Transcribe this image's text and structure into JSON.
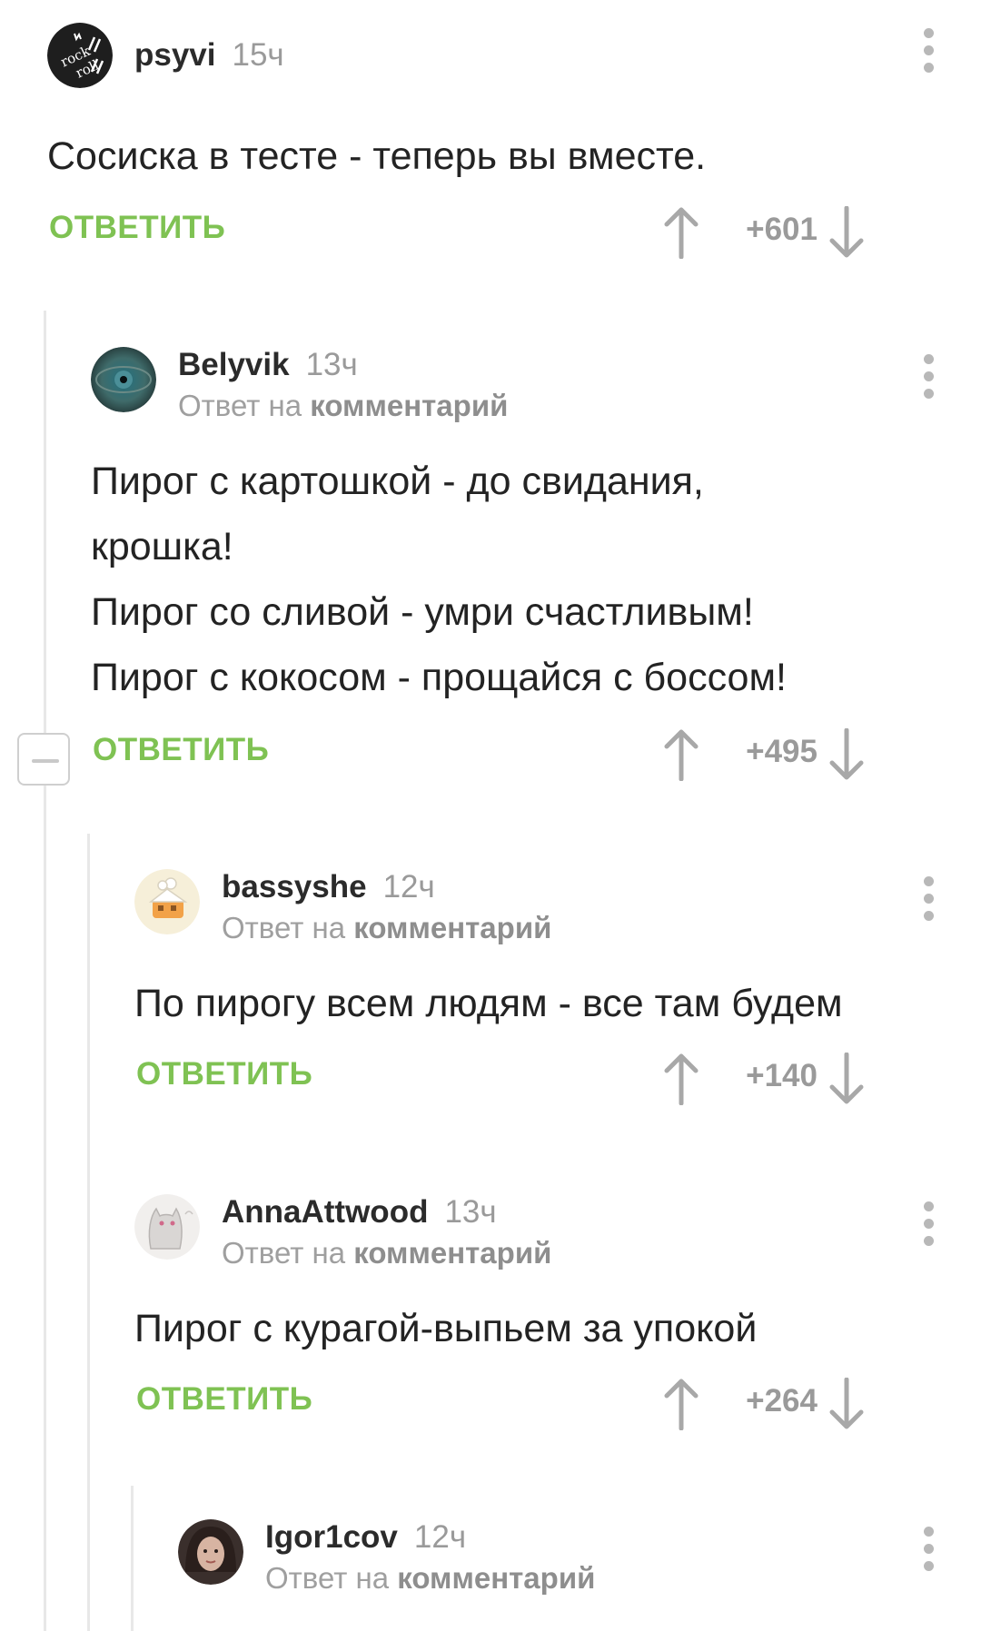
{
  "ui": {
    "reply_label": "ОТВЕТИТЬ",
    "reply_prefix": "Ответ на",
    "reply_target": "комментарий"
  },
  "comments": [
    {
      "username": "psyvi",
      "time": "15ч",
      "avatar": "rock-n-roll-logo",
      "text": [
        "Сосиска в тесте - теперь вы вместе."
      ],
      "score": "+601"
    },
    {
      "username": "Belyvik",
      "time": "13ч",
      "avatar": "eye-photo",
      "text": [
        "Пирог с картошкой - до свидания,",
        "крошка!",
        "Пирог со сливой - умри счастливым!",
        "Пирог с кокосом - прощайся с боссом!"
      ],
      "score": "+495"
    },
    {
      "username": "bassyshe",
      "time": "12ч",
      "avatar": "cartoon-house",
      "text": [
        "По пирогу всем людям - все там будем"
      ],
      "score": "+140"
    },
    {
      "username": "AnnaAttwood",
      "time": "13ч",
      "avatar": "sketch-cat",
      "text": [
        "Пирог с курагой-выпьем за упокой"
      ],
      "score": "+264"
    },
    {
      "username": "Igor1cov",
      "time": "12ч",
      "avatar": "person-photo"
    }
  ],
  "colors": {
    "reply_green": "#7fc253",
    "muted": "#9a9a9a",
    "thread_line": "#e8e8e8"
  }
}
